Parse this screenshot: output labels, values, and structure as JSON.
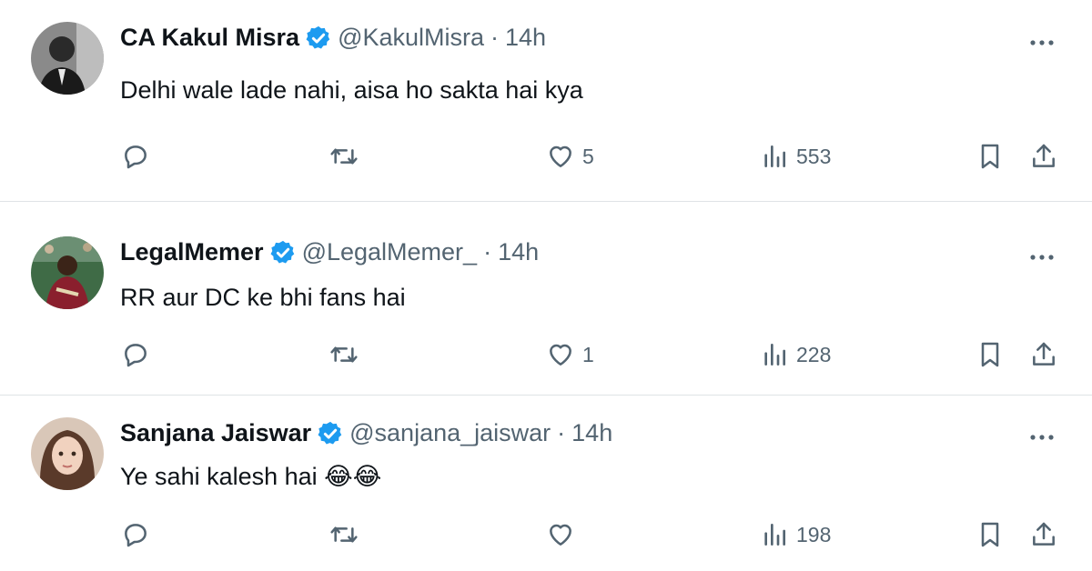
{
  "tweets": [
    {
      "name": "CA Kakul Misra",
      "handle": "@KakulMisra",
      "time": "14h",
      "text": "Delhi wale lade nahi, aisa ho sakta hai kya",
      "likes": "5",
      "views": "553",
      "avatar_icon": "man-bw-photo"
    },
    {
      "name": "LegalMemer",
      "handle": "@LegalMemer_",
      "time": "14h",
      "text": "RR aur DC ke bhi fans hai",
      "likes": "1",
      "views": "228",
      "avatar_icon": "cricketer-photo"
    },
    {
      "name": "Sanjana Jaiswar",
      "handle": "@sanjana_jaiswar",
      "time": "14h",
      "text": "Ye sahi kalesh hai 😂😂",
      "likes": "",
      "views": "198",
      "avatar_icon": "woman-portrait"
    }
  ],
  "separator": "·",
  "colors": {
    "verified": "#1d9bf0",
    "muted": "#536471",
    "divider": "#dfe3e6"
  }
}
